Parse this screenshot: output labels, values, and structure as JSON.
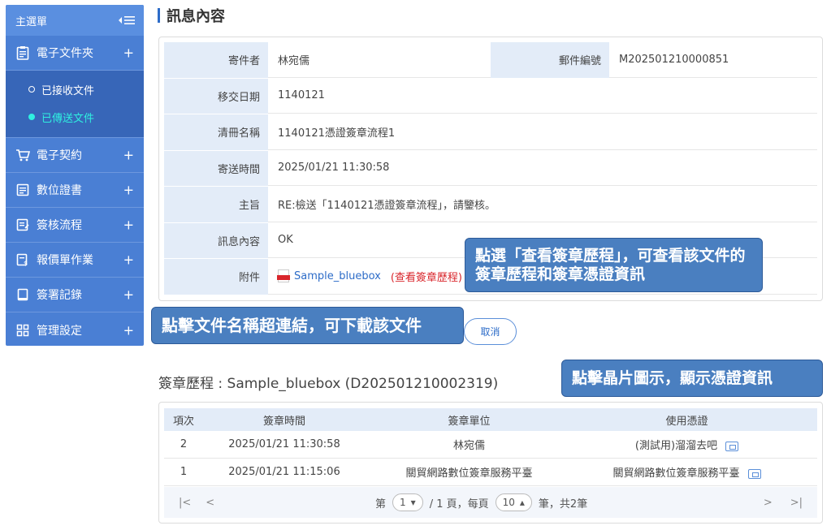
{
  "sidebar": {
    "header": "主選單",
    "items": [
      {
        "label": "電子文件夾",
        "icon": "clipboard-icon"
      },
      {
        "label": "電子契約",
        "icon": "cart-icon"
      },
      {
        "label": "數位證書",
        "icon": "certificate-icon"
      },
      {
        "label": "簽核流程",
        "icon": "form-icon"
      },
      {
        "label": "報價單作業",
        "icon": "quote-icon"
      },
      {
        "label": "簽署記錄",
        "icon": "record-icon"
      },
      {
        "label": "管理設定",
        "icon": "grid-icon"
      }
    ],
    "subitems": [
      {
        "label": "已接收文件"
      },
      {
        "label": "已傳送文件"
      }
    ]
  },
  "page": {
    "title": "訊息內容"
  },
  "info": {
    "sender_label": "寄件者",
    "sender": "林宛儒",
    "mail_no_label": "郵件編號",
    "mail_no": "M202501210000851",
    "date_label": "移交日期",
    "date": "1140121",
    "list_label": "清冊名稱",
    "list_name": "1140121憑證簽章流程1",
    "sent_label": "寄送時間",
    "sent_time": "2025/01/21 11:30:58",
    "subject_label": "主旨",
    "subject": "RE:檢送「1140121憑證簽章流程」，請鑒核。",
    "content_label": "訊息內容",
    "content": "OK",
    "attach_label": "附件",
    "attach_name": "Sample_bluebox",
    "attach_history": "(查看簽章歷程)"
  },
  "callouts": {
    "view_history": "點選「查看簽章歷程」，可查看該文件的簽章歷程和簽章憑證資訊",
    "download": "點擊文件名稱超連結，可下載該文件",
    "chip": "點擊晶片圖示，顯示憑證資訊"
  },
  "cancel_label": "取消",
  "history": {
    "title": "簽章歷程 : Sample_bluebox (D202501210002319)",
    "headers": [
      "項次",
      "簽章時間",
      "簽章單位",
      "使用憑證"
    ],
    "rows": [
      {
        "no": "2",
        "time": "2025/01/21 11:30:58",
        "unit": "林宛儒",
        "cert": "(測試用)溜溜去吧"
      },
      {
        "no": "1",
        "time": "2025/01/21 11:15:06",
        "unit": "關貿網路數位簽章服務平臺",
        "cert": "關貿網路數位簽章服務平臺"
      }
    ]
  },
  "pager": {
    "first": "|<",
    "prev": "<",
    "next": ">",
    "last": ">|",
    "page_prefix": "第",
    "page_value": "1",
    "page_suffix": "/ 1 頁，每頁",
    "size_value": "10",
    "size_suffix": "筆，共2筆"
  },
  "colors": {
    "sidebar": "#4a7fd4",
    "accent": "#2d6cc8",
    "active_sub": "#2ff0e0",
    "link_red": "#d9262c"
  }
}
